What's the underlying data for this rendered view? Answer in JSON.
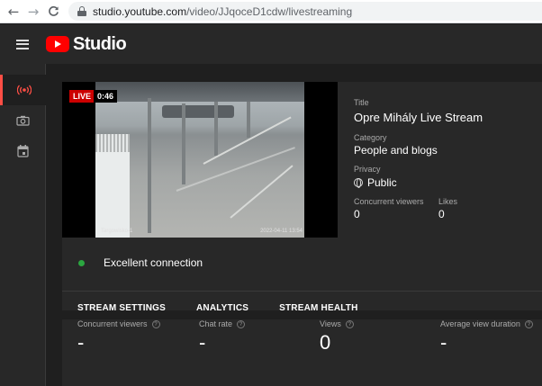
{
  "browser": {
    "back_icon": "arrow-left",
    "forward_icon": "arrow-right",
    "reload_icon": "reload",
    "url_host": "studio.youtube.com",
    "url_path": "/video/JJqoceD1cdw/livestreaming"
  },
  "header": {
    "studio_label": "Studio"
  },
  "sidebar": {
    "items": [
      {
        "icon": "live-broadcast-icon",
        "active": true
      },
      {
        "icon": "camera-icon",
        "active": false
      },
      {
        "icon": "calendar-icon",
        "active": false
      }
    ]
  },
  "player": {
    "live_badge": "LIVE",
    "elapsed": "0:46",
    "camera_name": "Targowisko-1",
    "camera_timestamp": "2022-04-11 13:54"
  },
  "info": {
    "title_label": "Title",
    "title_value": "Opre Mihály Live Stream",
    "category_label": "Category",
    "category_value": "People and blogs",
    "privacy_label": "Privacy",
    "privacy_value": "Public",
    "concurrent_label": "Concurrent viewers",
    "concurrent_value": "0",
    "likes_label": "Likes",
    "likes_value": "0"
  },
  "connection": {
    "status": "Excellent connection",
    "color": "#2ba640"
  },
  "tabs": [
    {
      "label": "STREAM SETTINGS",
      "active": false
    },
    {
      "label": "ANALYTICS",
      "active": true
    },
    {
      "label": "STREAM HEALTH",
      "active": false
    }
  ],
  "stats": [
    {
      "label": "Concurrent viewers",
      "value": "-"
    },
    {
      "label": "Chat rate",
      "value": "-"
    },
    {
      "label": "Views",
      "value": "0"
    },
    {
      "label": "Average view duration",
      "value": "-"
    }
  ],
  "colors": {
    "accent": "#ff0000",
    "active_indicator": "#ff4e45"
  }
}
